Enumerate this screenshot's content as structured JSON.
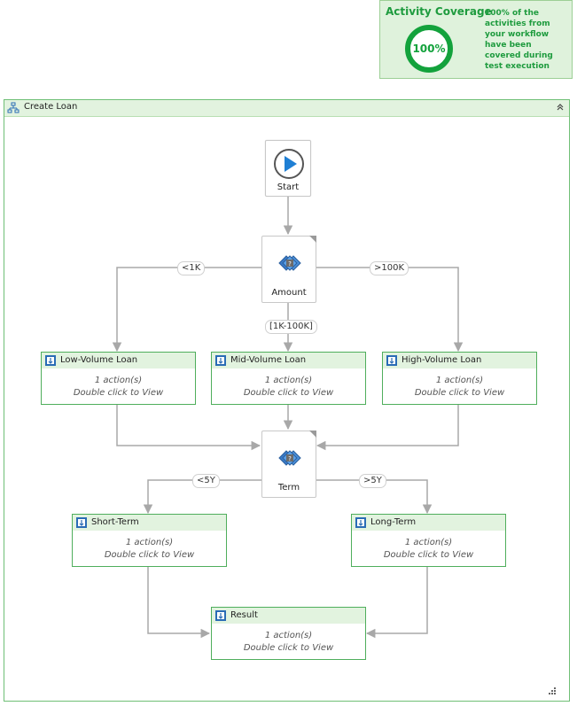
{
  "coverage": {
    "title": "Activity Coverage",
    "percent": "100%",
    "description": "100% of the activities from your workflow have been covered during test execution"
  },
  "sequence": {
    "title": "Create Loan"
  },
  "start": {
    "label": "Start"
  },
  "decisions": {
    "amount": {
      "label": "Amount"
    },
    "term": {
      "label": "Term"
    }
  },
  "branches": {
    "lt1k": "<1K",
    "mid": "[1K-100K]",
    "gt100k": ">100K",
    "lt5y": "<5Y",
    "gt5y": ">5Y"
  },
  "cards": {
    "low": {
      "title": "Low-Volume Loan",
      "actions": "1 action(s)",
      "hint": "Double click to View"
    },
    "mid": {
      "title": "Mid-Volume Loan",
      "actions": "1 action(s)",
      "hint": "Double click to View"
    },
    "high": {
      "title": "High-Volume Loan",
      "actions": "1 action(s)",
      "hint": "Double click to View"
    },
    "short": {
      "title": "Short-Term",
      "actions": "1 action(s)",
      "hint": "Double click to View"
    },
    "long": {
      "title": "Long-Term",
      "actions": "1 action(s)",
      "hint": "Double click to View"
    },
    "result": {
      "title": "Result",
      "actions": "1 action(s)",
      "hint": "Double click to View"
    }
  },
  "colors": {
    "accent_green": "#13a23c",
    "card_border": "#4fae5c",
    "header_fill": "#e2f3df",
    "connector": "#a8a8a8",
    "start_blue": "#1f7fd4"
  }
}
